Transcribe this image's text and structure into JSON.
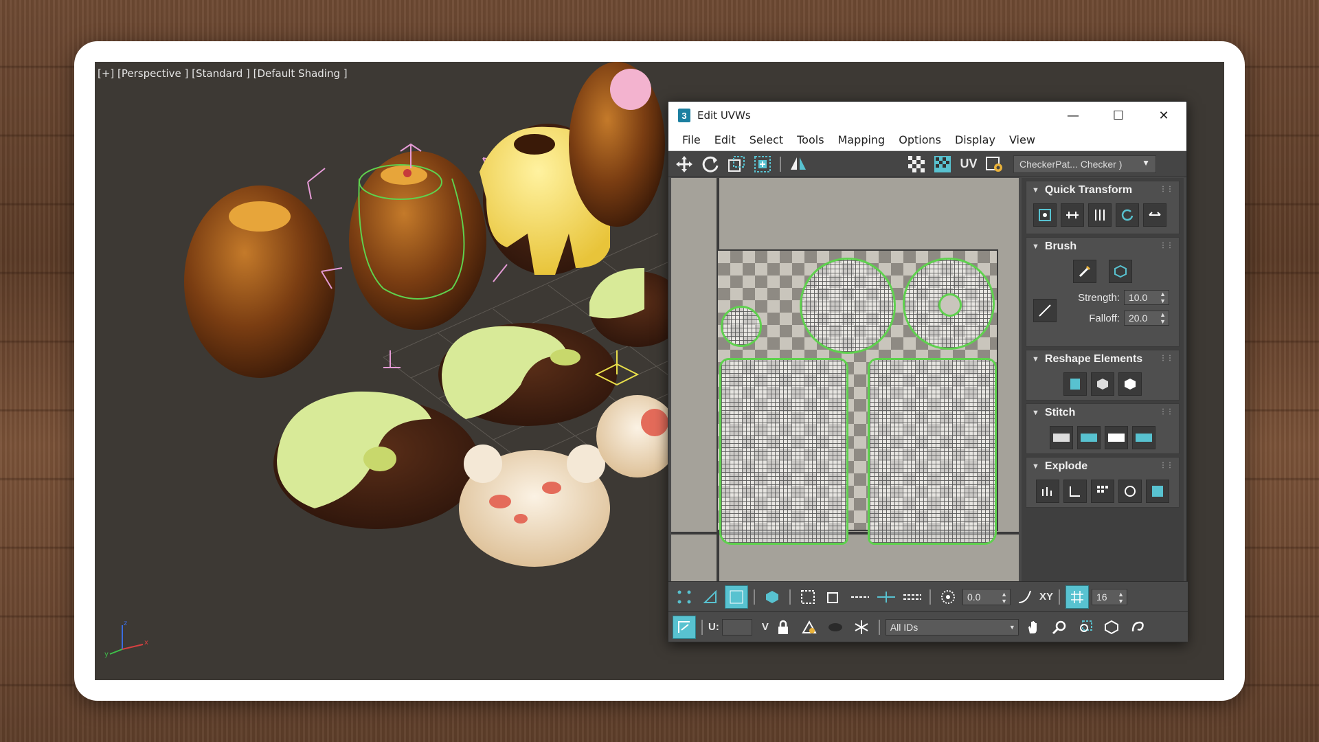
{
  "viewport": {
    "label": "[+] [Perspective ] [Standard ] [Default Shading ]"
  },
  "uvw_window": {
    "title": "Edit UVWs",
    "app_icon": "3",
    "menu": [
      "File",
      "Edit",
      "Select",
      "Tools",
      "Mapping",
      "Options",
      "Display",
      "View"
    ],
    "toolbar": {
      "uv_label": "UV",
      "checker_dropdown": "CheckerPat... Checker )"
    },
    "panels": {
      "quick_transform": "Quick Transform",
      "brush": {
        "title": "Brush",
        "strength_label": "Strength:",
        "strength_value": "10.0",
        "falloff_label": "Falloff:",
        "falloff_value": "20.0"
      },
      "reshape": "Reshape Elements",
      "stitch": "Stitch",
      "explode": "Explode"
    },
    "bottom": {
      "rotate_value": "0.0",
      "xy_label": "XY",
      "grid_value": "16",
      "u_label": "U:",
      "v_label": "V",
      "ids_dropdown": "All IDs"
    }
  },
  "colors": {
    "accent": "#58c2d0",
    "seam_green": "#5fd14e",
    "viewport_bg": "#3d3934"
  },
  "icons": {
    "move": "move-icon",
    "rotate": "rotate-icon",
    "scale": "scale-icon",
    "freeform": "freeform-icon",
    "mirror": "mirror-icon",
    "checker": "checker-icon",
    "settings": "settings-icon",
    "lock": "lock-icon",
    "snowflake": "freeze-icon",
    "hand": "pan-icon",
    "zoom": "zoom-icon"
  }
}
